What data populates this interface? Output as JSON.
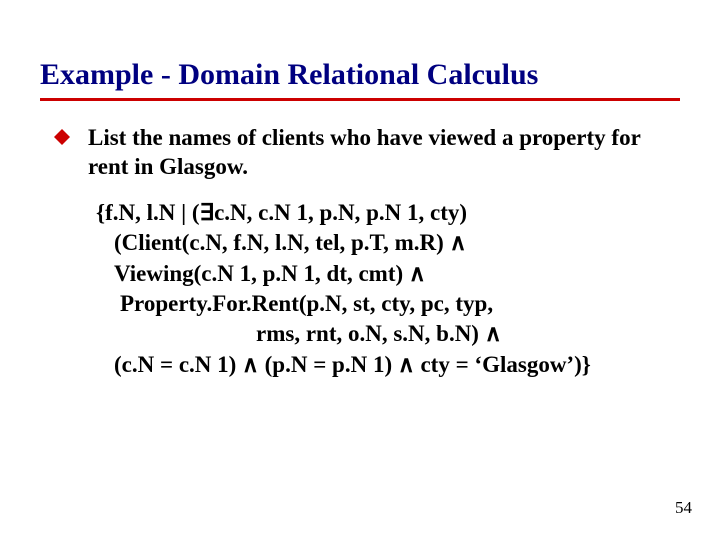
{
  "title": "Example - Domain Relational Calculus",
  "bullet": {
    "icon": "diamond-bullet-icon",
    "text": "List the names of clients who have viewed a property for rent in Glasgow."
  },
  "formula": {
    "line1": "{f.N, l.N | (∃c.N, c.N 1, p.N, p.N 1, cty)",
    "line2": "(Client(c.N, f.N, l.N, tel, p.T, m.R) ∧",
    "line3": "Viewing(c.N 1, p.N 1, dt, cmt) ∧",
    "line4": "Property.For.Rent(p.N, st, cty, pc, typ,",
    "line5": "rms, rnt, o.N, s.N, b.N) ∧",
    "line6": "(c.N = c.N 1) ∧ (p.N = p.N 1) ∧ cty = ‘Glasgow’)}"
  },
  "page_number": "54"
}
